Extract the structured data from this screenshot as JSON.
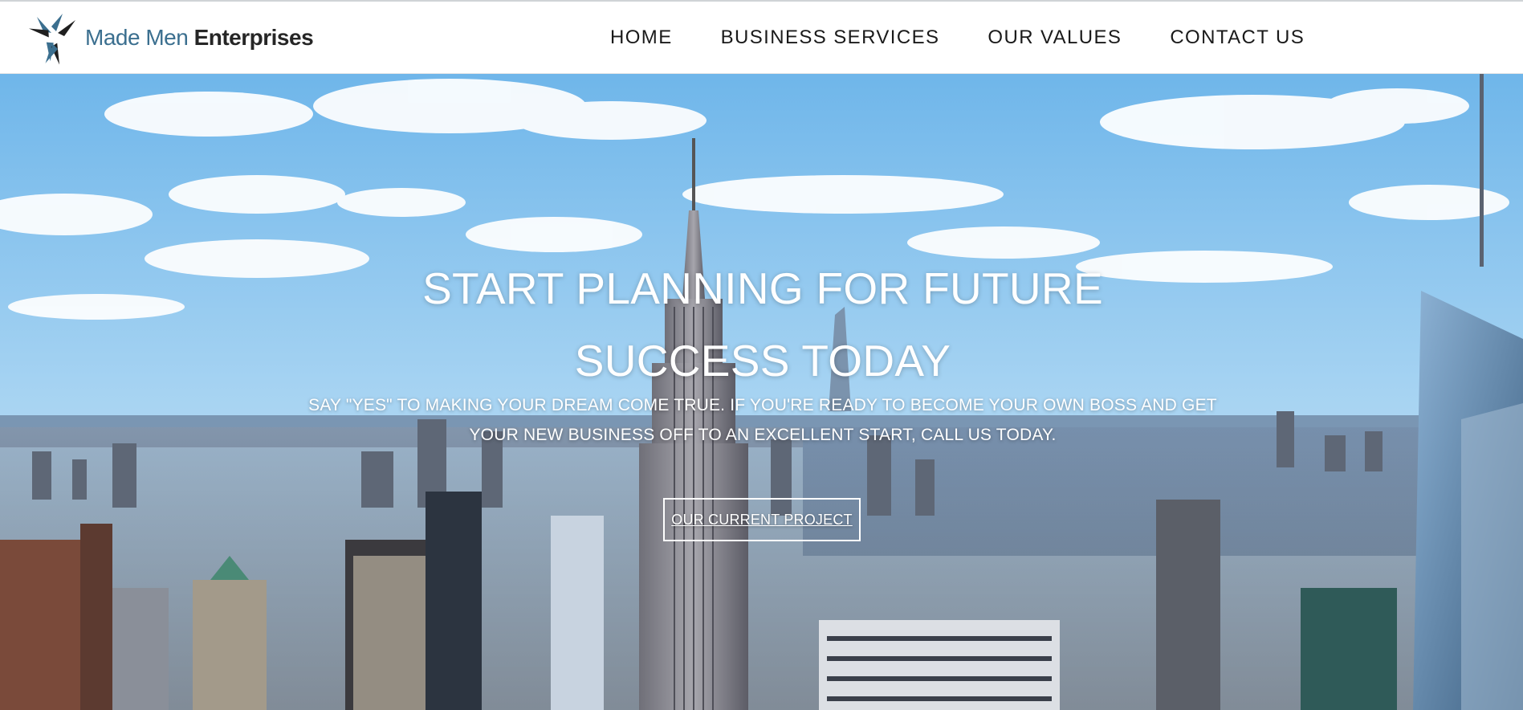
{
  "brand": {
    "name_part1": "Made Men",
    "name_part2": "Enterprises",
    "logo_icon": "pinwheel-arrows-icon",
    "colors": {
      "blue": "#3b6f8f",
      "dark": "#262626"
    }
  },
  "nav": {
    "items": [
      {
        "label": "HOME"
      },
      {
        "label": "BUSINESS SERVICES"
      },
      {
        "label": "OUR VALUES"
      },
      {
        "label": "CONTACT US"
      }
    ]
  },
  "hero": {
    "background": "new-york-skyline-photo",
    "headline": "START PLANNING FOR FUTURE SUCCESS TODAY",
    "subheadline": "SAY \"YES\" TO MAKING YOUR DREAM COME TRUE. IF YOU'RE READY TO BECOME YOUR OWN BOSS AND GET YOUR NEW BUSINESS OFF TO AN EXCELLENT START, CALL US TODAY.",
    "cta_label": "OUR CURRENT PROJECT"
  }
}
